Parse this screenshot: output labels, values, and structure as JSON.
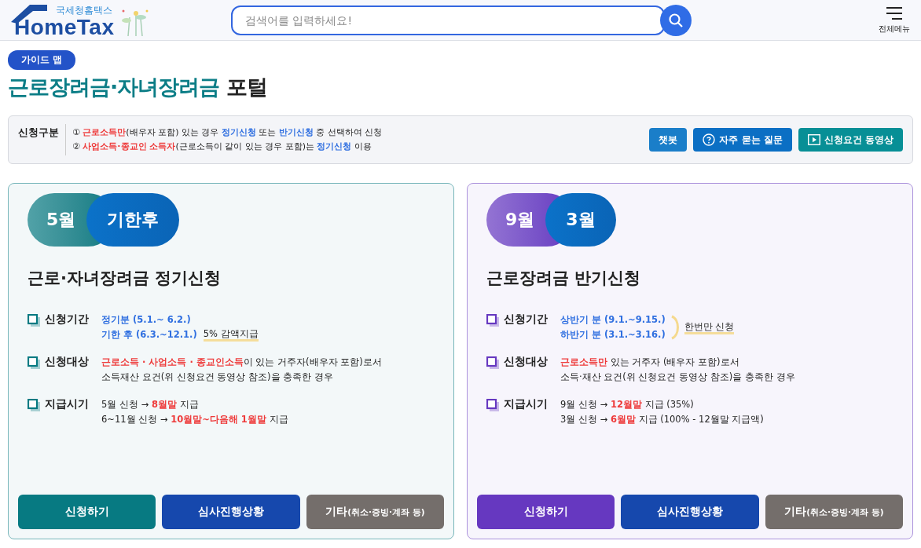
{
  "header": {
    "logo_small": "국세청홈택스",
    "logo_main": "HomeTax",
    "search": {
      "placeholder": "검색어를 입력하세요!"
    },
    "menu_label": "전체메뉴"
  },
  "guide_badge": "가이드 맵",
  "title": {
    "accent": "근로장려금·자녀장려금",
    "rest": "포털"
  },
  "info": {
    "label": "신청구분",
    "lines": [
      [
        {
          "text": "① "
        },
        {
          "text": "근로소득만",
          "color": "#ee3a3a"
        },
        {
          "text": "(배우자 포함) 있는 경우 "
        },
        {
          "text": "정기신청",
          "color": "#2f6fe0"
        },
        {
          "text": " 또는 "
        },
        {
          "text": "반기신청",
          "color": "#2f6fe0"
        },
        {
          "text": " 중 선택하여 신청"
        }
      ],
      [
        {
          "text": "② "
        },
        {
          "text": "사업소득·종교인 소득자",
          "color": "#ee3a3a"
        },
        {
          "text": "(근로소득이 같이 있는 경우 포함)는 "
        },
        {
          "text": "정기신청",
          "color": "#2f6fe0"
        },
        {
          "text": " 이용"
        }
      ]
    ],
    "buttons": [
      {
        "label": "챗봇",
        "kind": "chat"
      },
      {
        "label": "자주 묻는 질문",
        "kind": "faq"
      },
      {
        "label": "신청요건 동영상",
        "kind": "video"
      }
    ]
  },
  "cards": [
    {
      "color": "#077a82",
      "pills": [
        "5월",
        "기한후"
      ],
      "title": "근로·자녀장려금 정기신청",
      "rows": [
        {
          "label": "신청기간",
          "lines": [
            {
              "segments": [
                {
                  "text": "정기분 (5.1.~ 6.2.)",
                  "color": "#2f6fe0"
                }
              ]
            },
            {
              "segments": [
                {
                  "text": "기한 후 (6.3.~12.1.)",
                  "color": "#2f6fe0"
                }
              ],
              "note": "5% 감액지급"
            }
          ]
        },
        {
          "label": "신청대상",
          "lines": [
            {
              "segments": [
                {
                  "text": "근로소득 · 사업소득 · 종교인소득",
                  "color": "#ee3a3a"
                },
                {
                  "text": "이 있는 거주자(배우자 포함)로서"
                }
              ]
            },
            {
              "segments": [
                {
                  "text": "소득재산 요건(위 신청요건 동영상 참조)을 충족한 경우"
                }
              ]
            }
          ]
        },
        {
          "label": "지급시기",
          "lines": [
            {
              "segments": [
                {
                  "text": "5월 신청 → "
                },
                {
                  "text": "8월말",
                  "color": "#ee3a3a"
                },
                {
                  "text": " 지급"
                }
              ]
            },
            {
              "segments": [
                {
                  "text": "6~11월 신청 → "
                },
                {
                  "text": "10월말~다음해 1월말",
                  "color": "#ee3a3a"
                },
                {
                  "text": " 지급"
                }
              ]
            }
          ]
        }
      ],
      "buttons": [
        {
          "kind": "apply",
          "label": "신청하기"
        },
        {
          "kind": "status",
          "label": "심사진행상황"
        },
        {
          "kind": "other",
          "label": "기타",
          "sub": "(취소·증빙·계좌 등)"
        }
      ]
    },
    {
      "color": "#6638c0",
      "pills": [
        "9월",
        "3월"
      ],
      "title": "근로장려금 반기신청",
      "rows": [
        {
          "label": "신청기간",
          "bracket_note": "한번만 신청",
          "lines": [
            {
              "segments": [
                {
                  "text": "상반기 분 (9.1.~9.15.)",
                  "color": "#2f6fe0"
                }
              ]
            },
            {
              "segments": [
                {
                  "text": "하반기 분 (3.1.~3.16.)",
                  "color": "#2f6fe0"
                }
              ]
            }
          ]
        },
        {
          "label": "신청대상",
          "lines": [
            {
              "segments": [
                {
                  "text": "근로소득만",
                  "color": "#ee3a3a"
                },
                {
                  "text": " 있는 거주자 (배우자 포함)로서"
                }
              ]
            },
            {
              "segments": [
                {
                  "text": "소득·재산 요건(위 신청요건 동영상 참조)을 충족한 경우"
                }
              ]
            }
          ]
        },
        {
          "label": "지급시기",
          "lines": [
            {
              "segments": [
                {
                  "text": "9월 신청 → "
                },
                {
                  "text": "12월말",
                  "color": "#ee3a3a"
                },
                {
                  "text": " 지급 (35%)"
                }
              ]
            },
            {
              "segments": [
                {
                  "text": "3월 신청 → "
                },
                {
                  "text": "6월말",
                  "color": "#ee3a3a"
                },
                {
                  "text": " 지급 (100% - 12월말 지급액)"
                }
              ]
            }
          ]
        }
      ],
      "buttons": [
        {
          "kind": "apply",
          "label": "신청하기"
        },
        {
          "kind": "status",
          "label": "심사진행상황"
        },
        {
          "kind": "other",
          "label": "기타",
          "sub": "(취소·증빙·계좌 등)"
        }
      ]
    }
  ]
}
